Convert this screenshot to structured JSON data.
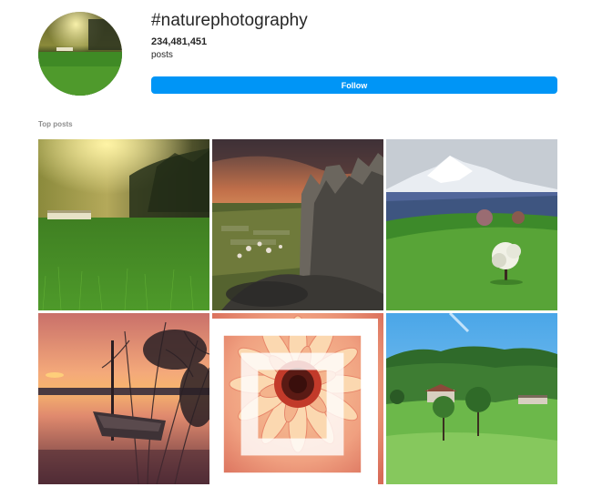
{
  "header": {
    "hashtag": "#naturephotography",
    "post_count": "234,481,451",
    "posts_label": "posts",
    "follow_label": "Follow"
  },
  "section": {
    "title": "Top posts"
  },
  "posts": [
    {
      "subject": "misty-green-field-sunlight"
    },
    {
      "subject": "rock-formation-sunset"
    },
    {
      "subject": "snowy-mountain-green-hill-tree"
    },
    {
      "subject": "sunset-lake-rowboat"
    },
    {
      "subject": "peach-flower-closeup"
    },
    {
      "subject": "green-hills-farmhouse"
    }
  ],
  "colors": {
    "accent": "#0095f6",
    "text": "#262626",
    "secondary_text": "#8e8e8e"
  }
}
